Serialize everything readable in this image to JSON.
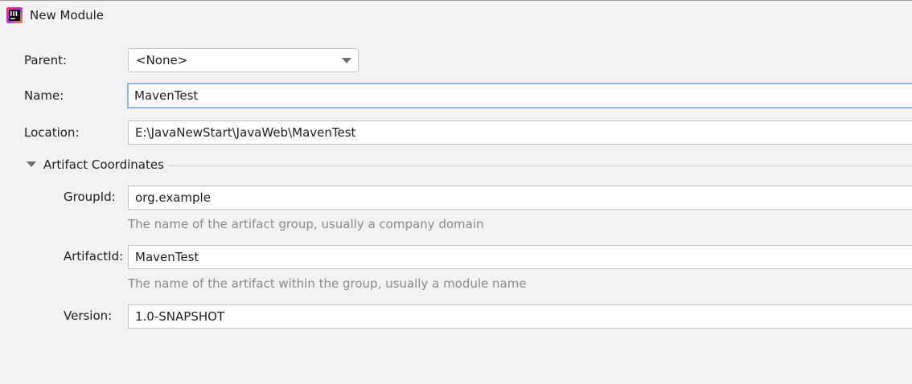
{
  "window": {
    "title": "New Module",
    "icon": "intellij-idea-icon"
  },
  "form": {
    "parent": {
      "label": "Parent:",
      "value": "<None>"
    },
    "name": {
      "label": "Name:",
      "value": "MavenTest"
    },
    "location": {
      "label": "Location:",
      "value": "E:\\JavaNewStart\\JavaWeb\\MavenTest"
    }
  },
  "artifact": {
    "section_title": "Artifact Coordinates",
    "group_id": {
      "label": "GroupId:",
      "value": "org.example",
      "hint": "The name of the artifact group, usually a company domain"
    },
    "artifact_id": {
      "label": "ArtifactId:",
      "value": "MavenTest",
      "hint": "The name of the artifact within the group, usually a module name"
    },
    "version": {
      "label": "Version:",
      "value": "1.0-SNAPSHOT"
    }
  },
  "colors": {
    "background": "#f2f2f2",
    "focus_border": "#8fb6e3",
    "hint_text": "#8a8a8a"
  }
}
